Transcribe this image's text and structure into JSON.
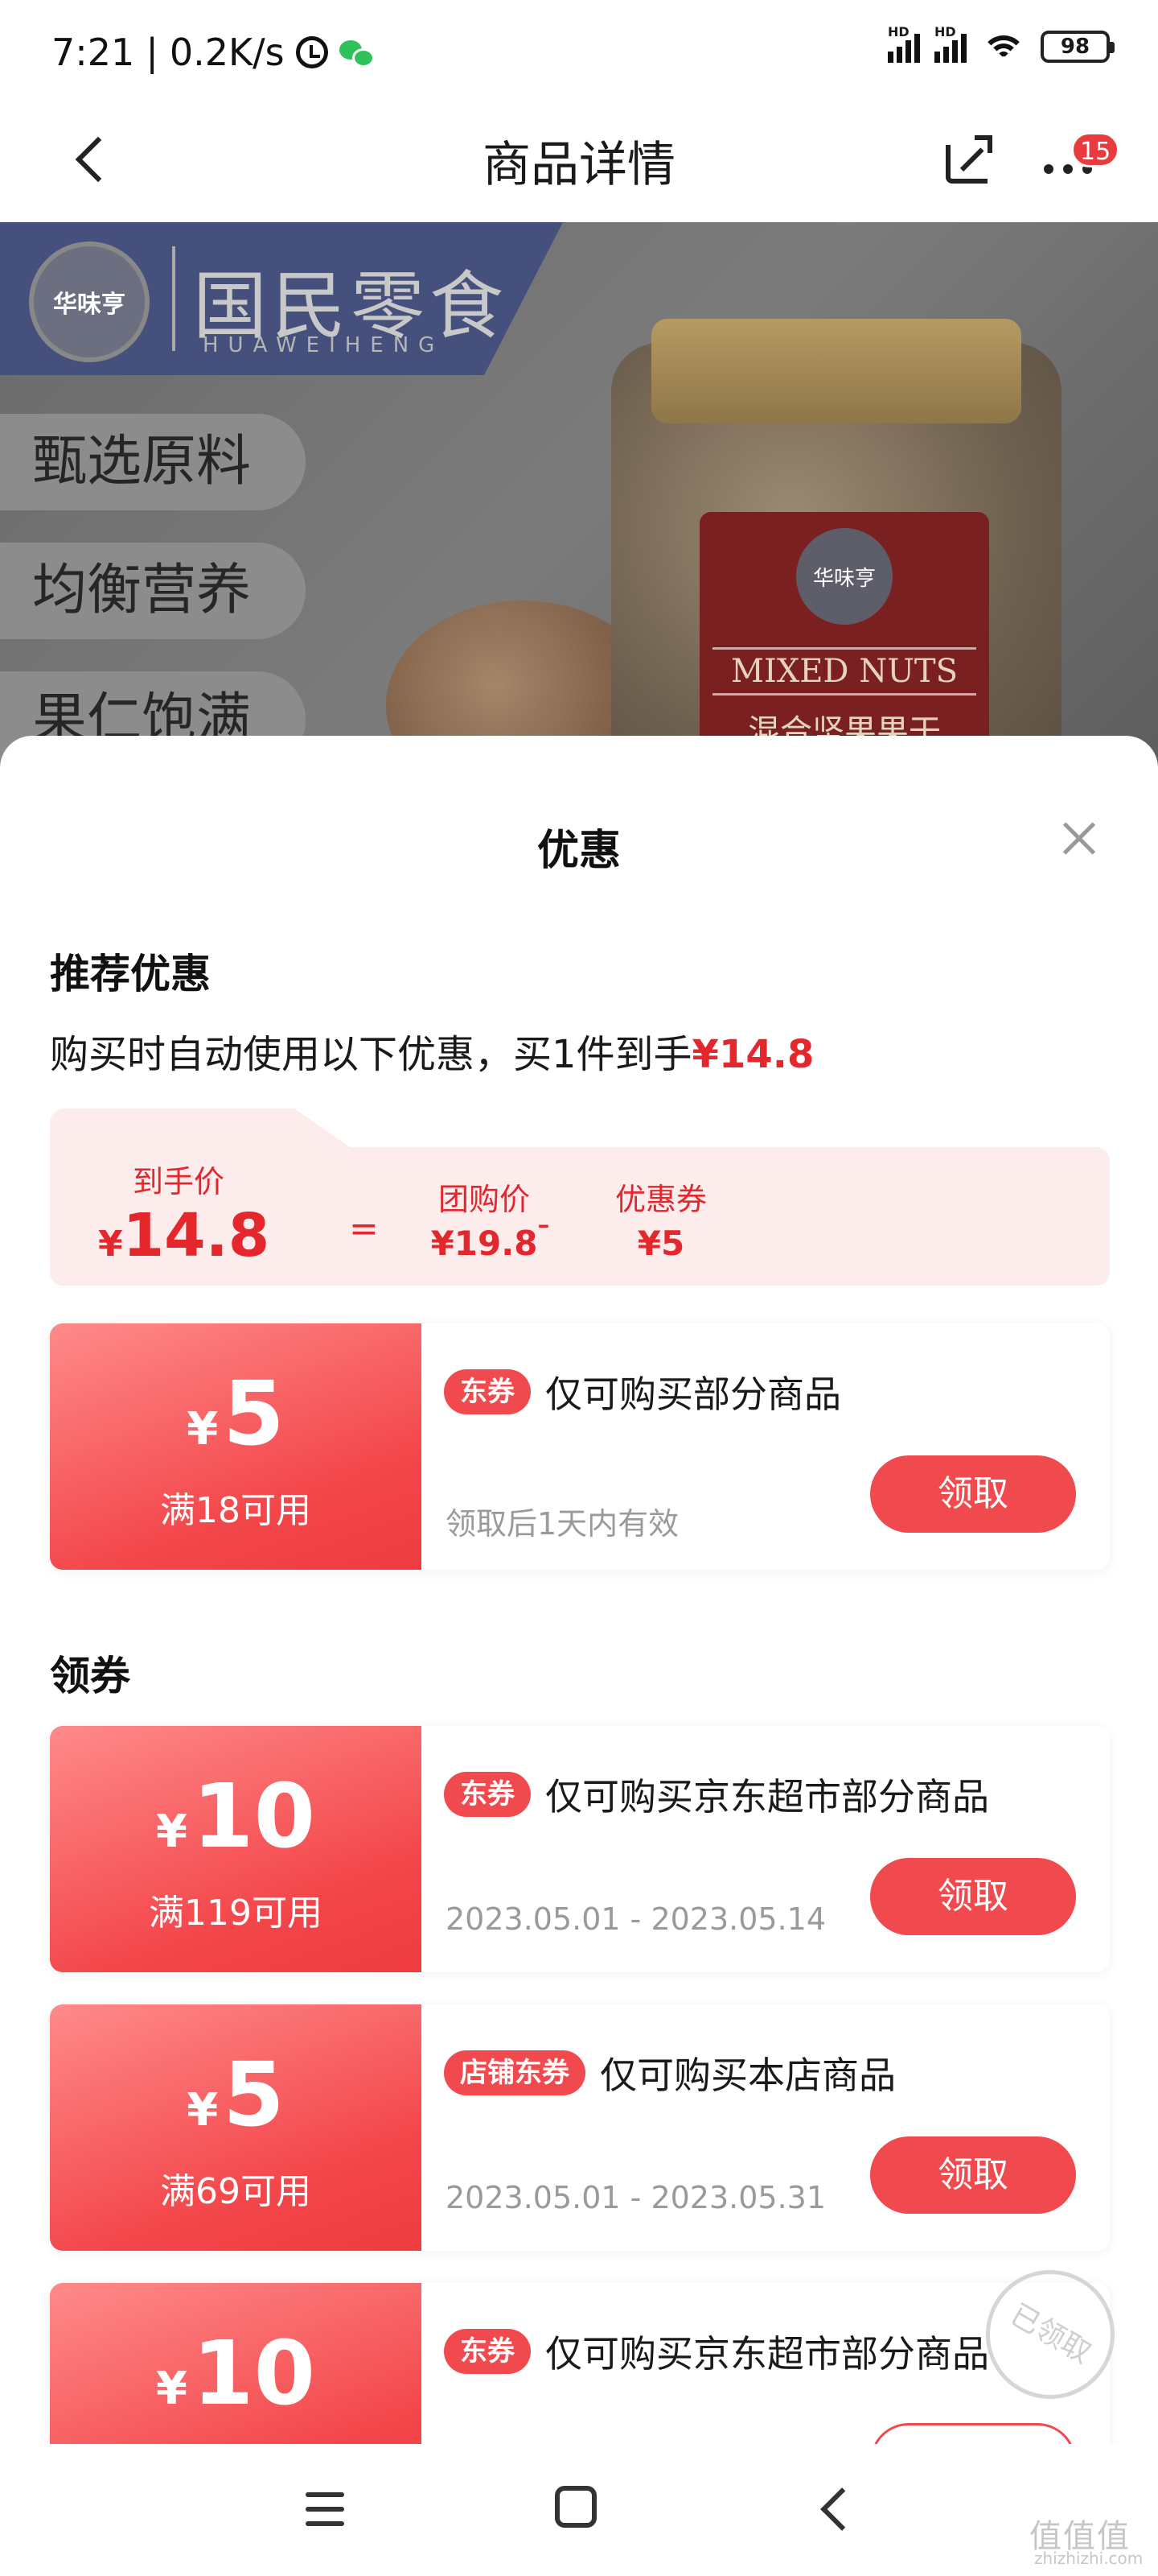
{
  "status_bar": {
    "time": "7:21",
    "net_speed": "0.2K/s",
    "battery": "98",
    "signal_label": "HD"
  },
  "header": {
    "title": "商品详情",
    "badge_count": "15"
  },
  "banner": {
    "brand_logo_text": "华味亨",
    "brand_name": "国民零食",
    "brand_sub": "HUAWEIHENG",
    "pills": [
      "甄选原料",
      "均衡营养",
      "果仁饱满"
    ],
    "product_label_en": "MIXED NUTS",
    "product_label_cn": "混合坚果果干"
  },
  "sheet": {
    "title": "优惠",
    "recommend_heading": "推荐优惠",
    "auto_text_prefix": "购买时自动使用以下优惠，买1件到手",
    "auto_text_price": "¥14.8",
    "calc": {
      "final_label": "到手价",
      "final_yen": "¥",
      "final_value": "14.8",
      "equals": "=",
      "group_label": "团购价",
      "group_value": "¥19.8",
      "minus": "-",
      "coupon_label": "优惠券",
      "coupon_value": "¥5"
    },
    "recommended_coupon": {
      "yen": "¥",
      "amount": "5",
      "condition": "满18可用",
      "tag": "东券",
      "desc": "仅可购买部分商品",
      "validity": "领取后1天内有效",
      "button": "领取"
    },
    "claim_heading": "领券",
    "coupons": [
      {
        "yen": "¥",
        "amount": "10",
        "condition": "满119可用",
        "tag": "东券",
        "desc": "仅可购买京东超市部分商品",
        "validity": "2023.05.01 - 2023.05.14",
        "button": "领取"
      },
      {
        "yen": "¥",
        "amount": "5",
        "condition": "满69可用",
        "tag": "店铺东券",
        "desc": "仅可购买本店商品",
        "validity": "2023.05.01 - 2023.05.31",
        "button": "领取"
      },
      {
        "yen": "¥",
        "amount": "10",
        "tag": "东券",
        "desc": "仅可购买京东超市部分商品"
      }
    ],
    "stamp_text": "已领取"
  },
  "watermark": {
    "main": "值值值",
    "sub": "zhizhizhi.com"
  }
}
